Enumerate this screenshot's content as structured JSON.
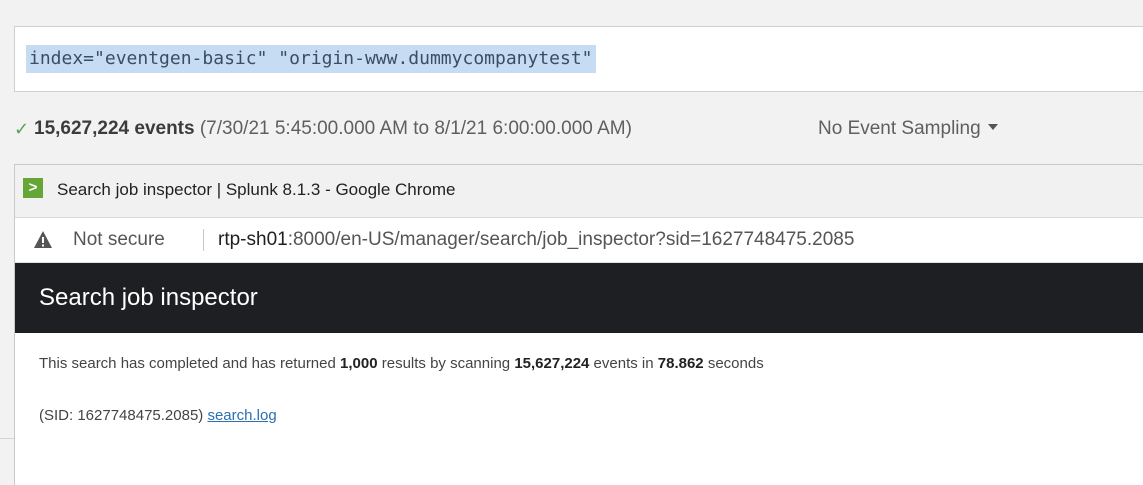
{
  "search": {
    "query": "index=\"eventgen-basic\" \"origin-www.dummycompanytest\""
  },
  "summary": {
    "check_icon": "✓",
    "event_count": "15,627,224 events",
    "time_range": "(7/30/21 5:45:00.000 AM to 8/1/21 6:00:00.000 AM)",
    "sampling_label": "No Event Sampling"
  },
  "chrome_window": {
    "app_icon_glyph": ">",
    "title": "Search job inspector | Splunk 8.1.3 - Google Chrome",
    "security_label": "Not secure",
    "url_host": "rtp-sh01",
    "url_rest": ":8000/en-US/manager/search/job_inspector?sid=1627748475.2085"
  },
  "inspector": {
    "header": "Search job inspector",
    "completion": {
      "prefix": "This search has completed and has returned ",
      "results": "1,000",
      "middle": " results by scanning ",
      "events": "15,627,224",
      "events_suffix": " events in ",
      "seconds": "78.862",
      "suffix": " seconds"
    },
    "sid_text": "(SID: 1627748475.2085) ",
    "log_link": "search.log"
  },
  "colors": {
    "query_highlight": "#c6dcf2",
    "check_green": "#5aa05a",
    "header_bg": "#1d1f22",
    "link": "#2b6fb4",
    "splunk_green": "#65a637"
  }
}
